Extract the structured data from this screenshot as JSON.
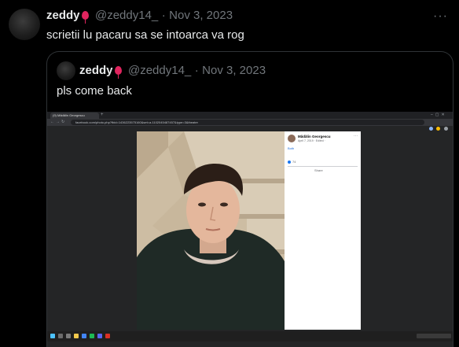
{
  "tweet": {
    "display_name": "zeddy",
    "handle": "@zeddy14_",
    "separator": "·",
    "date": "Nov 3, 2023",
    "more_label": "···",
    "text": "scrietii lu pacaru sa se intoarca va rog"
  },
  "quoted_tweet": {
    "display_name": "zeddy",
    "handle": "@zeddy14_",
    "separator": "·",
    "date": "Nov 3, 2023",
    "text": "pls come back",
    "screenshot": {
      "tab_title": "(9) Mădălin Georgescu",
      "url": "facebook.com/photo.php?fbid=1436223575160&set=a.1102045487457&type=3&theater",
      "poster_name": "Mădălin Georgescu",
      "post_date": "April 7, 2019 · Edited ·",
      "caption": "Both",
      "like_count": "74",
      "share_label": "Share"
    }
  },
  "colors": {
    "background": "#000000",
    "text": "#e7e9ea",
    "muted": "#71767b",
    "border": "#2f3336",
    "balloon": "#e0245e"
  }
}
